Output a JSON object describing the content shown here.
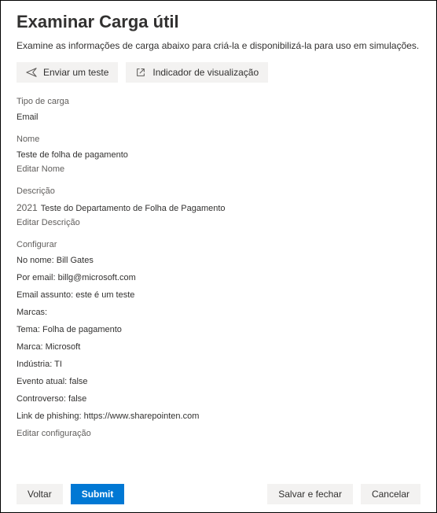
{
  "title": "Examinar Carga útil",
  "subtitle": "Examine as informações de carga abaixo para criá-la e disponibilizá-la para uso em simulações.",
  "toolbar": {
    "send_test": "Enviar um teste",
    "preview": "Indicador de visualização"
  },
  "sections": {
    "type": {
      "label": "Tipo de carga",
      "value": "Email"
    },
    "name": {
      "label": "Nome",
      "value": "Teste de folha de pagamento",
      "edit": "Editar Nome"
    },
    "description": {
      "label": "Descrição",
      "year": "2021",
      "value": "Teste do Departamento de Folha de Pagamento",
      "edit": "Editar Descrição"
    },
    "config": {
      "label": "Configurar",
      "from_name": "No nome: Bill Gates",
      "from_email": "Por email: billg@microsoft.com",
      "email_subject": "Email assunto: este é um teste",
      "tags": "Marcas:",
      "theme": "Tema: Folha de pagamento",
      "brand": "Marca: Microsoft",
      "industry": "Indústria: TI",
      "current_event": "Evento atual: false",
      "controversial": "Controverso: false",
      "phishing_link": "Link de phishing: https://www.sharepointen.com",
      "edit": "Editar configuração"
    }
  },
  "footer": {
    "back": "Voltar",
    "submit": "Submit",
    "save_close": "Salvar e fechar",
    "cancel": "Cancelar"
  }
}
